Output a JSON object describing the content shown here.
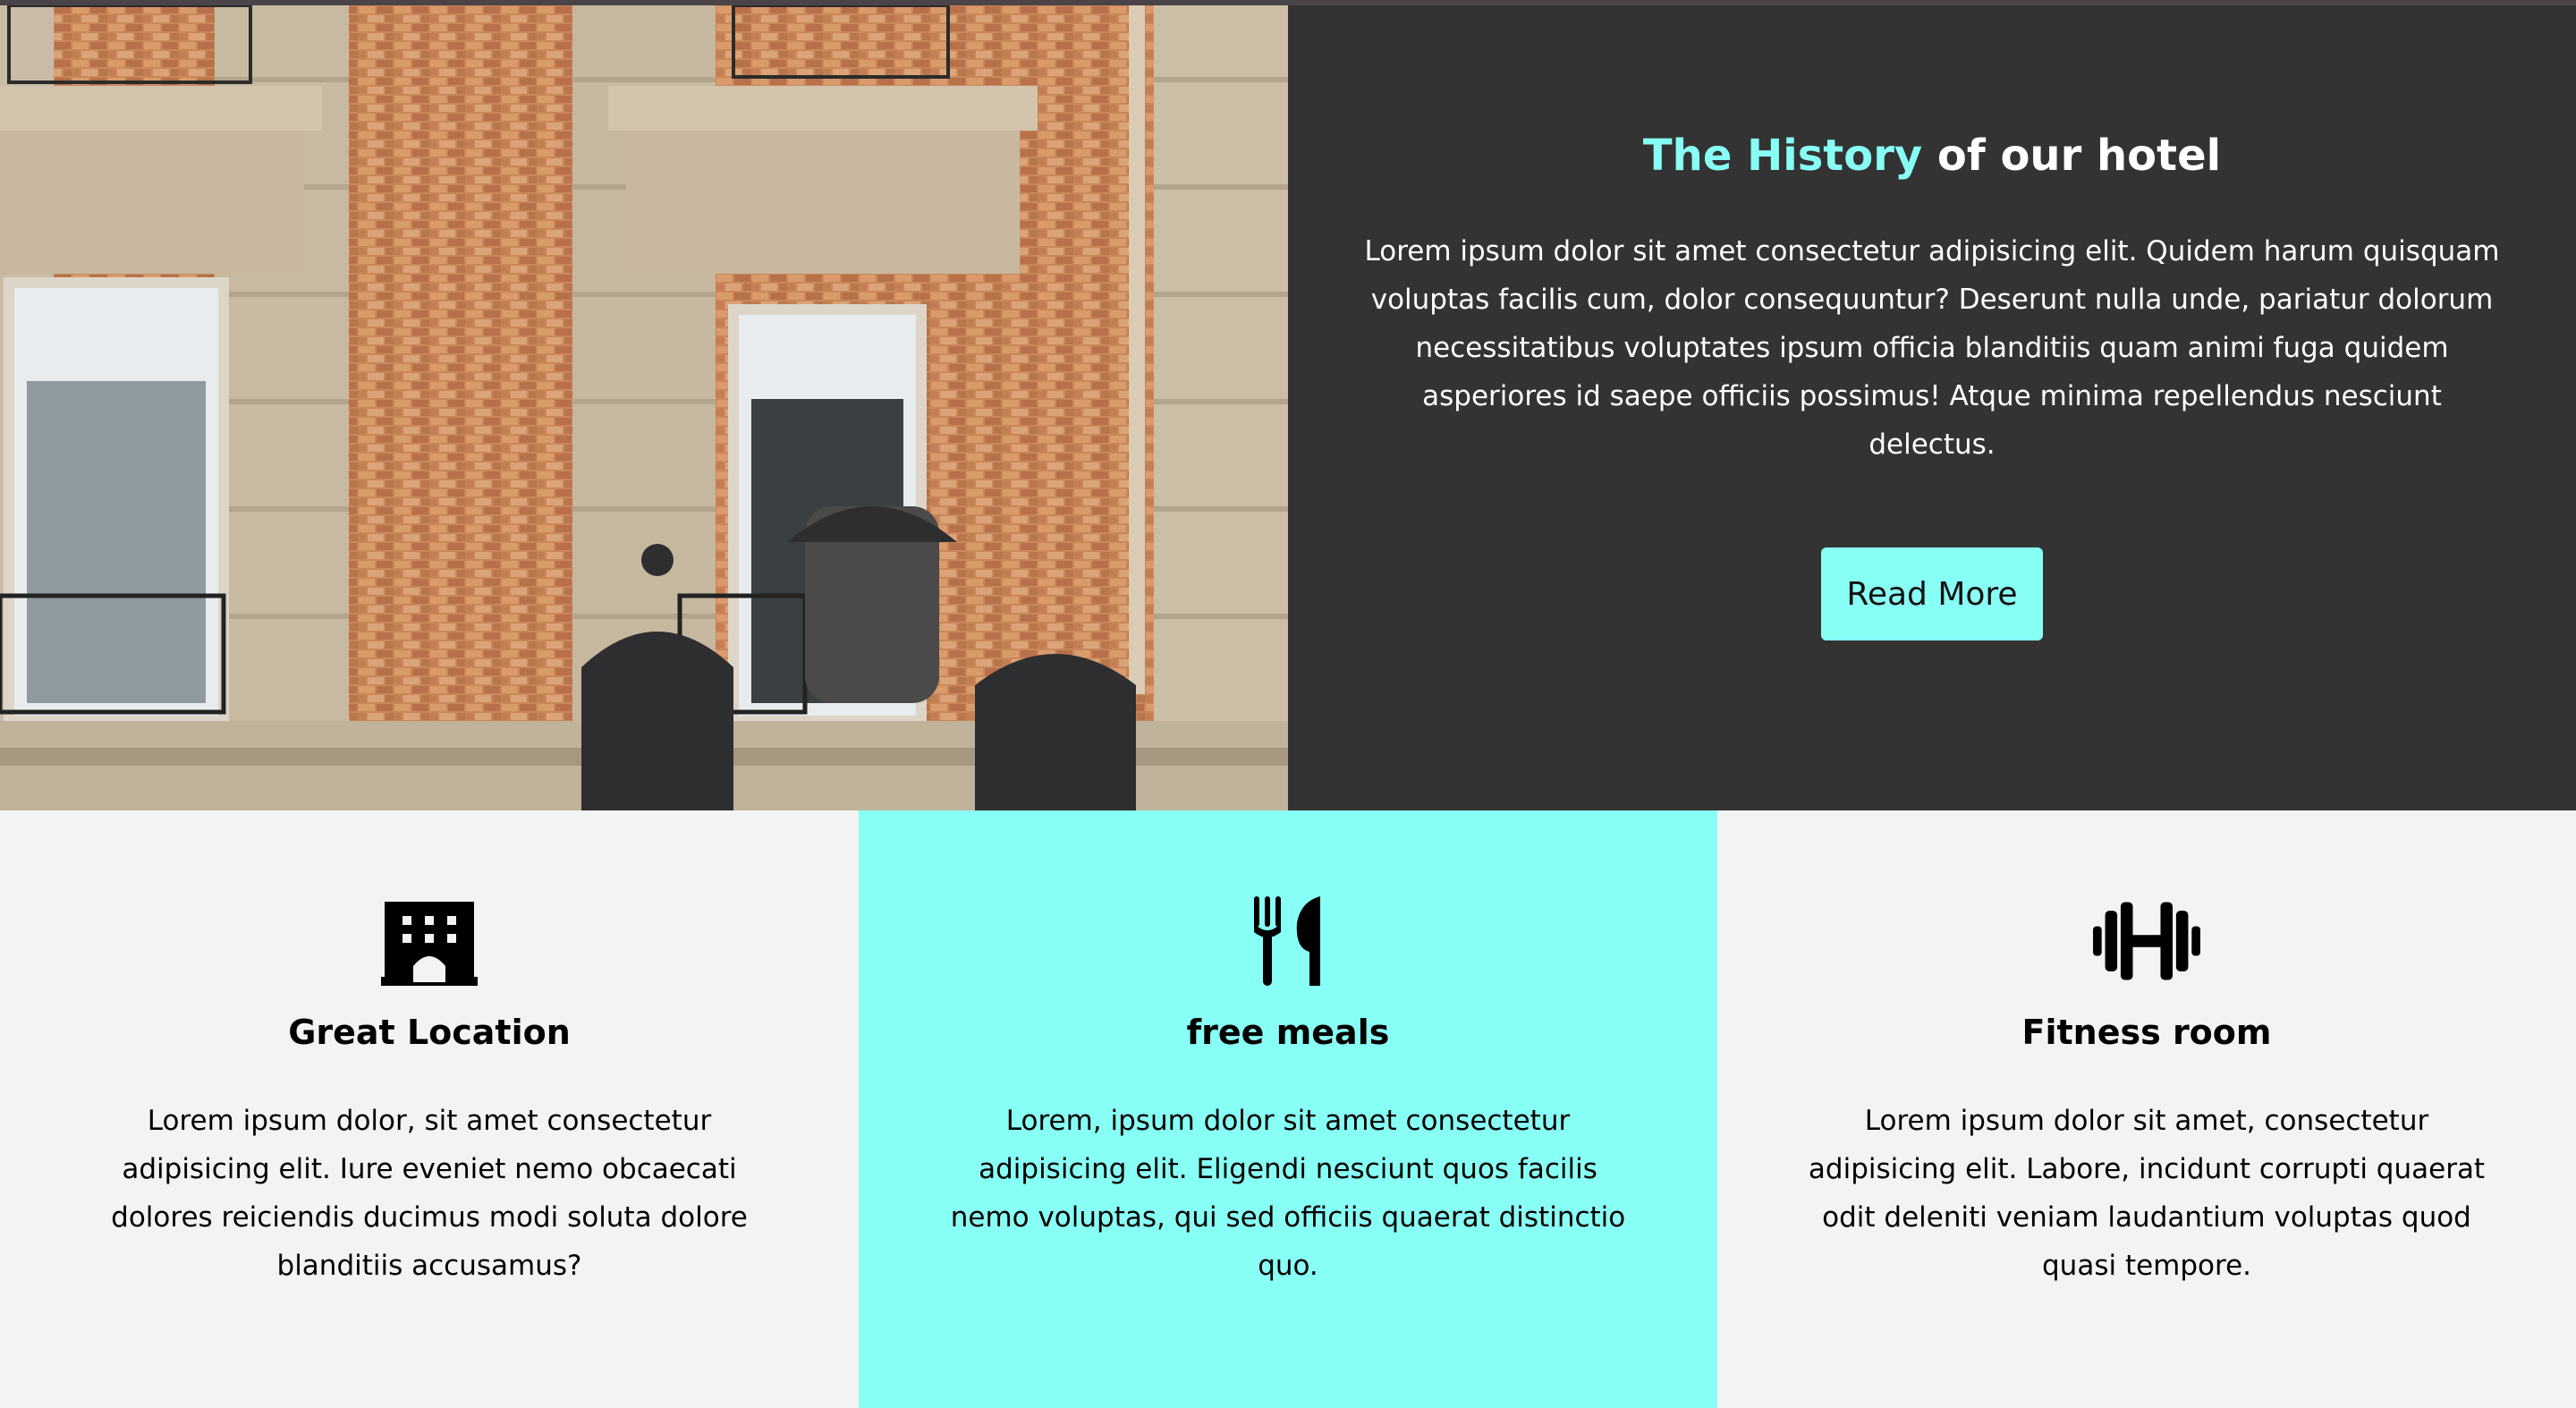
{
  "history": {
    "title_accent": "The History",
    "title_rest": " of our hotel",
    "body": "Lorem ipsum dolor sit amet consectetur adipisicing elit. Quidem harum quisquam voluptas facilis cum, dolor consequuntur? Deserunt nulla unde, pariatur dolorum necessitatibus voluptates ipsum officia blanditiis quam animi fuga quidem asperiores id saepe officiis possimus! Atque minima repellendus nesciunt delectus.",
    "button_label": "Read More",
    "photo_icon": "hotel-facade-photo"
  },
  "features": [
    {
      "icon": "building-icon",
      "title": "Great Location",
      "text": "Lorem ipsum dolor, sit amet consectetur adipisicing elit. Iure eveniet nemo obcaecati dolores reiciendis ducimus modi soluta dolore blanditiis accusamus?"
    },
    {
      "icon": "utensils-icon",
      "title": "free meals",
      "text": "Lorem, ipsum dolor sit amet consectetur adipisicing elit. Eligendi nesciunt quos facilis nemo voluptas, qui sed officiis quaerat distinctio quo."
    },
    {
      "icon": "dumbbell-icon",
      "title": "Fitness room",
      "text": "Lorem ipsum dolor sit amet, consectetur adipisicing elit. Labore, incidunt corrupti quaerat odit deleniti veniam laudantium voluptas quod quasi tempore."
    }
  ],
  "colors": {
    "accent": "#88fff5",
    "dark_panel": "#333333",
    "light_bg": "#f3f3f3"
  }
}
